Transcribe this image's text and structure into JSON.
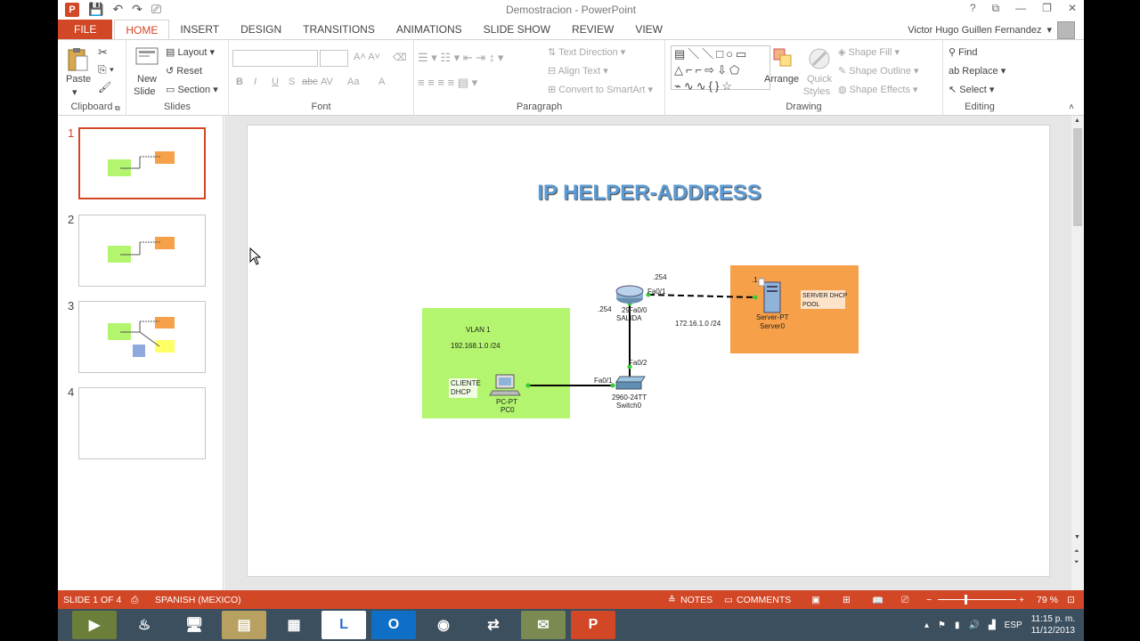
{
  "window": {
    "title": "Demostracion - PowerPoint",
    "user": "Victor Hugo Guillen Fernandez",
    "controls": [
      "?",
      "⧉",
      "—",
      "❐",
      "✕"
    ]
  },
  "tabs": [
    "FILE",
    "HOME",
    "INSERT",
    "DESIGN",
    "TRANSITIONS",
    "ANIMATIONS",
    "SLIDE SHOW",
    "REVIEW",
    "VIEW"
  ],
  "active_tab": "HOME",
  "ribbon": {
    "clipboard": {
      "label": "Clipboard",
      "paste": "Paste"
    },
    "slides": {
      "label": "Slides",
      "new_slide_1": "New",
      "new_slide_2": "Slide",
      "layout": "Layout",
      "reset": "Reset",
      "section": "Section"
    },
    "font": {
      "label": "Font",
      "buttons": [
        "B",
        "I",
        "U",
        "S",
        "abc",
        "AV",
        "Aa",
        "A"
      ]
    },
    "paragraph": {
      "label": "Paragraph",
      "text_direction": "Text Direction",
      "align_text": "Align Text",
      "convert": "Convert to SmartArt"
    },
    "drawing": {
      "label": "Drawing",
      "arrange": "Arrange",
      "quick_styles_1": "Quick",
      "quick_styles_2": "Styles",
      "shape_fill": "Shape Fill",
      "shape_outline": "Shape Outline",
      "shape_effects": "Shape Effects"
    },
    "editing": {
      "label": "Editing",
      "find": "Find",
      "replace": "Replace",
      "select": "Select"
    }
  },
  "slides_panel": [
    "1",
    "2",
    "3",
    "4"
  ],
  "slide": {
    "title": "IP HELPER-ADDRESS",
    "labels": {
      "vlan": "VLAN 1",
      "net_left": "192.168.1.0 /24",
      "client1": "CLIENTE",
      "client2": "DHCP",
      "pc_type": "PC-PT",
      "pc_name": "PC0",
      "switch_type": "2960-24TT",
      "switch_name": "Switch0",
      "router_model": "29",
      "router_port_down": "Fa0/0",
      "router_name": "SALIDA",
      "router_port_right": "Fa0/1",
      "gw_left": ".254",
      "gw_right": ".254",
      "switch_up_port": "Fa0/2",
      "switch_left_port": "Fa0/1",
      "net_right": "172.16.1.0 /24",
      "server_ip": ".1",
      "server_type": "Server-PT",
      "server_name": "Server0",
      "server_note1": "SERVER DHCP",
      "server_note2": "POOL"
    }
  },
  "statusbar": {
    "slide_info": "SLIDE 1 OF 4",
    "language": "SPANISH (MEXICO)",
    "notes": "NOTES",
    "comments": "COMMENTS",
    "zoom": "79 %"
  },
  "taskbar": {
    "lang": "ESP",
    "time": "11:15 p. m.",
    "date": "11/12/2013"
  },
  "colors": {
    "accent": "#d24726",
    "green_zone": "#b3f56e",
    "orange_zone": "#f7a04a",
    "title_blue": "#5b9bd5"
  }
}
